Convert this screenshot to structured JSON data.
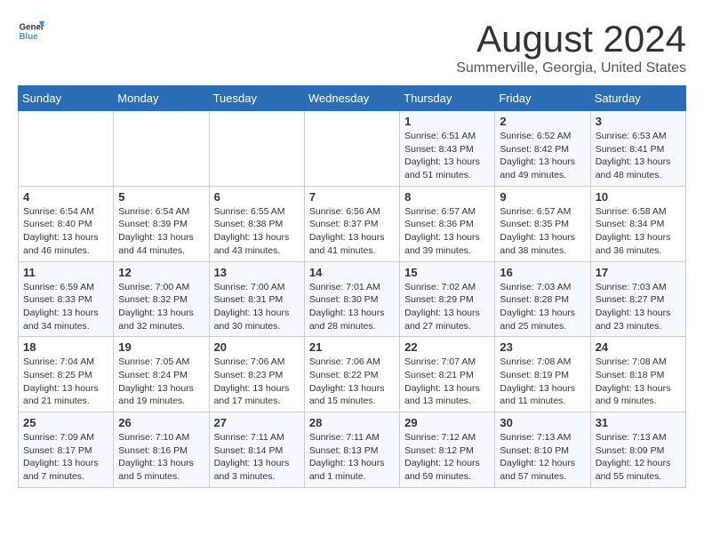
{
  "header": {
    "logo_general": "General",
    "logo_blue": "Blue",
    "main_title": "August 2024",
    "subtitle": "Summerville, Georgia, United States"
  },
  "columns": [
    "Sunday",
    "Monday",
    "Tuesday",
    "Wednesday",
    "Thursday",
    "Friday",
    "Saturday"
  ],
  "weeks": [
    [
      {
        "day": "",
        "info": ""
      },
      {
        "day": "",
        "info": ""
      },
      {
        "day": "",
        "info": ""
      },
      {
        "day": "",
        "info": ""
      },
      {
        "day": "1",
        "info": "Sunrise: 6:51 AM\nSunset: 8:43 PM\nDaylight: 13 hours\nand 51 minutes."
      },
      {
        "day": "2",
        "info": "Sunrise: 6:52 AM\nSunset: 8:42 PM\nDaylight: 13 hours\nand 49 minutes."
      },
      {
        "day": "3",
        "info": "Sunrise: 6:53 AM\nSunset: 8:41 PM\nDaylight: 13 hours\nand 48 minutes."
      }
    ],
    [
      {
        "day": "4",
        "info": "Sunrise: 6:54 AM\nSunset: 8:40 PM\nDaylight: 13 hours\nand 46 minutes."
      },
      {
        "day": "5",
        "info": "Sunrise: 6:54 AM\nSunset: 8:39 PM\nDaylight: 13 hours\nand 44 minutes."
      },
      {
        "day": "6",
        "info": "Sunrise: 6:55 AM\nSunset: 8:38 PM\nDaylight: 13 hours\nand 43 minutes."
      },
      {
        "day": "7",
        "info": "Sunrise: 6:56 AM\nSunset: 8:37 PM\nDaylight: 13 hours\nand 41 minutes."
      },
      {
        "day": "8",
        "info": "Sunrise: 6:57 AM\nSunset: 8:36 PM\nDaylight: 13 hours\nand 39 minutes."
      },
      {
        "day": "9",
        "info": "Sunrise: 6:57 AM\nSunset: 8:35 PM\nDaylight: 13 hours\nand 38 minutes."
      },
      {
        "day": "10",
        "info": "Sunrise: 6:58 AM\nSunset: 8:34 PM\nDaylight: 13 hours\nand 36 minutes."
      }
    ],
    [
      {
        "day": "11",
        "info": "Sunrise: 6:59 AM\nSunset: 8:33 PM\nDaylight: 13 hours\nand 34 minutes."
      },
      {
        "day": "12",
        "info": "Sunrise: 7:00 AM\nSunset: 8:32 PM\nDaylight: 13 hours\nand 32 minutes."
      },
      {
        "day": "13",
        "info": "Sunrise: 7:00 AM\nSunset: 8:31 PM\nDaylight: 13 hours\nand 30 minutes."
      },
      {
        "day": "14",
        "info": "Sunrise: 7:01 AM\nSunset: 8:30 PM\nDaylight: 13 hours\nand 28 minutes."
      },
      {
        "day": "15",
        "info": "Sunrise: 7:02 AM\nSunset: 8:29 PM\nDaylight: 13 hours\nand 27 minutes."
      },
      {
        "day": "16",
        "info": "Sunrise: 7:03 AM\nSunset: 8:28 PM\nDaylight: 13 hours\nand 25 minutes."
      },
      {
        "day": "17",
        "info": "Sunrise: 7:03 AM\nSunset: 8:27 PM\nDaylight: 13 hours\nand 23 minutes."
      }
    ],
    [
      {
        "day": "18",
        "info": "Sunrise: 7:04 AM\nSunset: 8:25 PM\nDaylight: 13 hours\nand 21 minutes."
      },
      {
        "day": "19",
        "info": "Sunrise: 7:05 AM\nSunset: 8:24 PM\nDaylight: 13 hours\nand 19 minutes."
      },
      {
        "day": "20",
        "info": "Sunrise: 7:06 AM\nSunset: 8:23 PM\nDaylight: 13 hours\nand 17 minutes."
      },
      {
        "day": "21",
        "info": "Sunrise: 7:06 AM\nSunset: 8:22 PM\nDaylight: 13 hours\nand 15 minutes."
      },
      {
        "day": "22",
        "info": "Sunrise: 7:07 AM\nSunset: 8:21 PM\nDaylight: 13 hours\nand 13 minutes."
      },
      {
        "day": "23",
        "info": "Sunrise: 7:08 AM\nSunset: 8:19 PM\nDaylight: 13 hours\nand 11 minutes."
      },
      {
        "day": "24",
        "info": "Sunrise: 7:08 AM\nSunset: 8:18 PM\nDaylight: 13 hours\nand 9 minutes."
      }
    ],
    [
      {
        "day": "25",
        "info": "Sunrise: 7:09 AM\nSunset: 8:17 PM\nDaylight: 13 hours\nand 7 minutes."
      },
      {
        "day": "26",
        "info": "Sunrise: 7:10 AM\nSunset: 8:16 PM\nDaylight: 13 hours\nand 5 minutes."
      },
      {
        "day": "27",
        "info": "Sunrise: 7:11 AM\nSunset: 8:14 PM\nDaylight: 13 hours\nand 3 minutes."
      },
      {
        "day": "28",
        "info": "Sunrise: 7:11 AM\nSunset: 8:13 PM\nDaylight: 13 hours\nand 1 minute."
      },
      {
        "day": "29",
        "info": "Sunrise: 7:12 AM\nSunset: 8:12 PM\nDaylight: 12 hours\nand 59 minutes."
      },
      {
        "day": "30",
        "info": "Sunrise: 7:13 AM\nSunset: 8:10 PM\nDaylight: 12 hours\nand 57 minutes."
      },
      {
        "day": "31",
        "info": "Sunrise: 7:13 AM\nSunset: 8:09 PM\nDaylight: 12 hours\nand 55 minutes."
      }
    ]
  ]
}
